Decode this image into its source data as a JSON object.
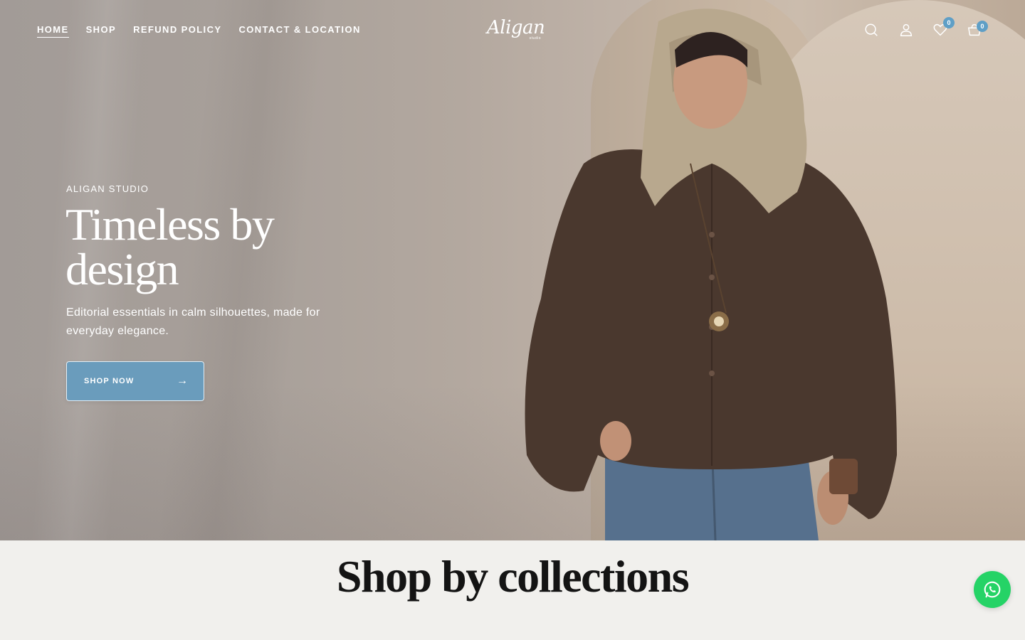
{
  "nav": {
    "items": [
      {
        "label": "HOME",
        "active": true
      },
      {
        "label": "SHOP",
        "active": false
      },
      {
        "label": "REFUND POLICY",
        "active": false
      },
      {
        "label": "CONTACT & LOCATION",
        "active": false
      }
    ]
  },
  "brand": {
    "logo_word": "Aligan",
    "logo_sub": "studio"
  },
  "header_icons": {
    "search": "search-icon",
    "account": "user-icon",
    "wishlist": "heart-icon",
    "cart": "bag-icon",
    "wishlist_count": "0",
    "cart_count": "0"
  },
  "hero": {
    "eyebrow": "ALIGAN STUDIO",
    "headline": "Timeless by design",
    "subcopy": "Editorial essentials in calm silhouettes, made for everyday elegance.",
    "cta_label": "SHOP NOW",
    "cta_arrow": "→"
  },
  "collections": {
    "title": "Shop by collections"
  },
  "colors": {
    "accent": "#6a9cbc",
    "badge": "#5f9fc6",
    "whatsapp": "#25d366",
    "section_bg": "#f1f0ed"
  },
  "whatsapp": {
    "icon": "whatsapp-icon"
  }
}
